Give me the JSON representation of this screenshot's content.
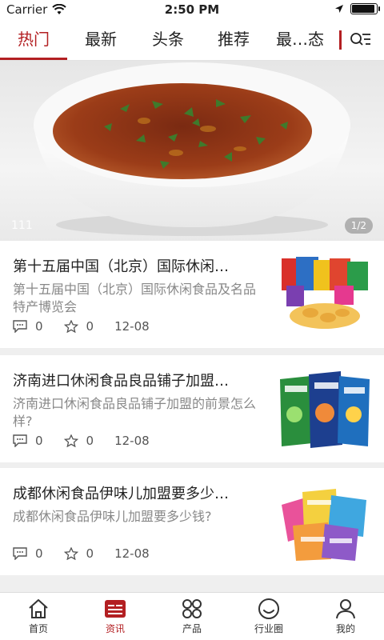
{
  "status_bar": {
    "carrier": "Carrier",
    "time": "2:50 PM",
    "battery_level": 0.95
  },
  "tabs": [
    {
      "label": "热门",
      "active": true
    },
    {
      "label": "最新",
      "active": false
    },
    {
      "label": "头条",
      "active": false
    },
    {
      "label": "推荐",
      "active": false
    },
    {
      "label": "最…态",
      "active": false
    }
  ],
  "banner": {
    "caption": "111",
    "counter": "1/2"
  },
  "news": [
    {
      "title": "第十五届中国（北京）国际休闲…",
      "summary": "第十五届中国（北京）国际休闲食品及名品特产博览会",
      "comments": "0",
      "likes": "0",
      "date": "12-08"
    },
    {
      "title": "济南进口休闲食品良品铺子加盟…",
      "summary": "济南进口休闲食品良品铺子加盟的前景怎么样?",
      "comments": "0",
      "likes": "0",
      "date": "12-08"
    },
    {
      "title": "成都休闲食品伊味儿加盟要多少…",
      "summary": "成都休闲食品伊味儿加盟要多少钱?",
      "comments": "0",
      "likes": "0",
      "date": "12-08"
    }
  ],
  "tabbar": [
    {
      "label": "首页",
      "icon": "home-icon",
      "active": false
    },
    {
      "label": "资讯",
      "icon": "news-icon",
      "active": true
    },
    {
      "label": "产品",
      "icon": "products-icon",
      "active": false
    },
    {
      "label": "行业圈",
      "icon": "community-icon",
      "active": false
    },
    {
      "label": "我的",
      "icon": "profile-icon",
      "active": false
    }
  ],
  "colors": {
    "accent": "#b31f22",
    "muted_text": "#888888",
    "background": "#efefef"
  }
}
